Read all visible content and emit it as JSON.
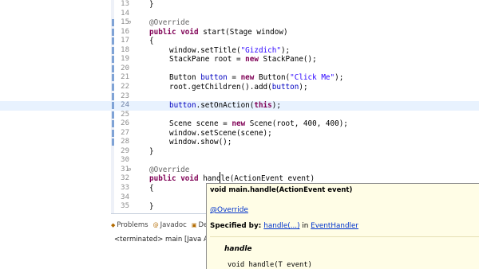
{
  "editor": {
    "lines": [
      {
        "num": "13",
        "fold": "",
        "marker": false,
        "current": false,
        "indent": 0,
        "tokens": [
          {
            "t": "}",
            "c": ""
          }
        ]
      },
      {
        "num": "14",
        "fold": "",
        "marker": false,
        "current": false,
        "indent": 0,
        "tokens": []
      },
      {
        "num": "15",
        "fold": "⊖",
        "marker": true,
        "current": false,
        "indent": 0,
        "tokens": [
          {
            "t": "@Override",
            "c": "ann"
          }
        ]
      },
      {
        "num": "16",
        "fold": "",
        "marker": true,
        "current": false,
        "indent": 0,
        "tokens": [
          {
            "t": "public",
            "c": "kw"
          },
          {
            "t": " ",
            "c": ""
          },
          {
            "t": "void",
            "c": "kw"
          },
          {
            "t": " start(Stage window)",
            "c": ""
          }
        ]
      },
      {
        "num": "17",
        "fold": "",
        "marker": true,
        "current": false,
        "indent": 0,
        "tokens": [
          {
            "t": "{",
            "c": ""
          }
        ]
      },
      {
        "num": "18",
        "fold": "",
        "marker": true,
        "current": false,
        "indent": 1,
        "tokens": [
          {
            "t": "window.setTitle(",
            "c": ""
          },
          {
            "t": "\"Gizdich\"",
            "c": "str"
          },
          {
            "t": ");",
            "c": ""
          }
        ]
      },
      {
        "num": "19",
        "fold": "",
        "marker": true,
        "current": false,
        "indent": 1,
        "tokens": [
          {
            "t": "StackPane root = ",
            "c": ""
          },
          {
            "t": "new",
            "c": "kw"
          },
          {
            "t": " StackPane();",
            "c": ""
          }
        ]
      },
      {
        "num": "20",
        "fold": "",
        "marker": true,
        "current": false,
        "indent": 0,
        "tokens": []
      },
      {
        "num": "21",
        "fold": "",
        "marker": true,
        "current": false,
        "indent": 1,
        "tokens": [
          {
            "t": "Button ",
            "c": ""
          },
          {
            "t": "button",
            "c": "field"
          },
          {
            "t": " = ",
            "c": ""
          },
          {
            "t": "new",
            "c": "kw"
          },
          {
            "t": " Button(",
            "c": ""
          },
          {
            "t": "\"Click Me\"",
            "c": "str"
          },
          {
            "t": ");",
            "c": ""
          }
        ]
      },
      {
        "num": "22",
        "fold": "",
        "marker": true,
        "current": false,
        "indent": 1,
        "tokens": [
          {
            "t": "root.getChildren().add(",
            "c": ""
          },
          {
            "t": "button",
            "c": "field"
          },
          {
            "t": ");",
            "c": ""
          }
        ]
      },
      {
        "num": "23",
        "fold": "",
        "marker": true,
        "current": false,
        "indent": 0,
        "tokens": []
      },
      {
        "num": "24",
        "fold": "",
        "marker": true,
        "current": true,
        "indent": 1,
        "tokens": [
          {
            "t": "button",
            "c": "field"
          },
          {
            "t": ".setOnAction(",
            "c": ""
          },
          {
            "t": "this",
            "c": "kw"
          },
          {
            "t": ");",
            "c": ""
          }
        ]
      },
      {
        "num": "25",
        "fold": "",
        "marker": true,
        "current": false,
        "indent": 0,
        "tokens": []
      },
      {
        "num": "26",
        "fold": "",
        "marker": true,
        "current": false,
        "indent": 1,
        "tokens": [
          {
            "t": "Scene scene = ",
            "c": ""
          },
          {
            "t": "new",
            "c": "kw"
          },
          {
            "t": " Scene(root, 400, 400);",
            "c": ""
          }
        ]
      },
      {
        "num": "27",
        "fold": "",
        "marker": true,
        "current": false,
        "indent": 1,
        "tokens": [
          {
            "t": "window.setScene(scene);",
            "c": ""
          }
        ]
      },
      {
        "num": "28",
        "fold": "",
        "marker": true,
        "current": false,
        "indent": 1,
        "tokens": [
          {
            "t": "window.show();",
            "c": ""
          }
        ]
      },
      {
        "num": "29",
        "fold": "",
        "marker": false,
        "current": false,
        "indent": 0,
        "tokens": [
          {
            "t": "}",
            "c": ""
          }
        ]
      },
      {
        "num": "30",
        "fold": "",
        "marker": false,
        "current": false,
        "indent": 0,
        "tokens": []
      },
      {
        "num": "31",
        "fold": "⊖",
        "marker": false,
        "current": false,
        "indent": 0,
        "tokens": [
          {
            "t": "@Override",
            "c": "ann"
          }
        ]
      },
      {
        "num": "32",
        "fold": "",
        "marker": false,
        "current": false,
        "indent": 0,
        "tokens": [
          {
            "t": "public",
            "c": "kw"
          },
          {
            "t": " ",
            "c": ""
          },
          {
            "t": "void",
            "c": "kw"
          },
          {
            "t": " handle(ActionEvent event)",
            "c": ""
          }
        ]
      },
      {
        "num": "33",
        "fold": "",
        "marker": false,
        "current": false,
        "indent": 0,
        "tokens": [
          {
            "t": "{",
            "c": ""
          }
        ]
      },
      {
        "num": "34",
        "fold": "",
        "marker": false,
        "current": false,
        "indent": 0,
        "tokens": []
      },
      {
        "num": "35",
        "fold": "",
        "marker": false,
        "current": false,
        "indent": 0,
        "tokens": [
          {
            "t": "}",
            "c": ""
          }
        ]
      }
    ]
  },
  "bottom_panel": {
    "tabs": [
      {
        "icon": "problems-icon",
        "glyph": "◆",
        "label": "Problems"
      },
      {
        "icon": "javadoc-icon",
        "glyph": "@",
        "label": "Javadoc"
      },
      {
        "icon": "declaration-icon",
        "glyph": "▣",
        "label": "Decla"
      }
    ],
    "console_text": "<terminated> main [Java Appl"
  },
  "hover_popup": {
    "signature": "void main.handle(ActionEvent event)",
    "override_link": "@Override",
    "specified_label": "Specified by: ",
    "specified_method": "handle(...)",
    "specified_in": " in ",
    "specified_type": "EventHandler",
    "doc_title": "handle",
    "doc_code": "void handle(T event)"
  },
  "colors": {
    "keyword": "#7f0055",
    "string": "#2a00ff",
    "annotation": "#646464",
    "field": "#0000c0",
    "current_line": "#e8f2fe",
    "popup_bg": "#fffde6",
    "link": "#0033cc"
  }
}
